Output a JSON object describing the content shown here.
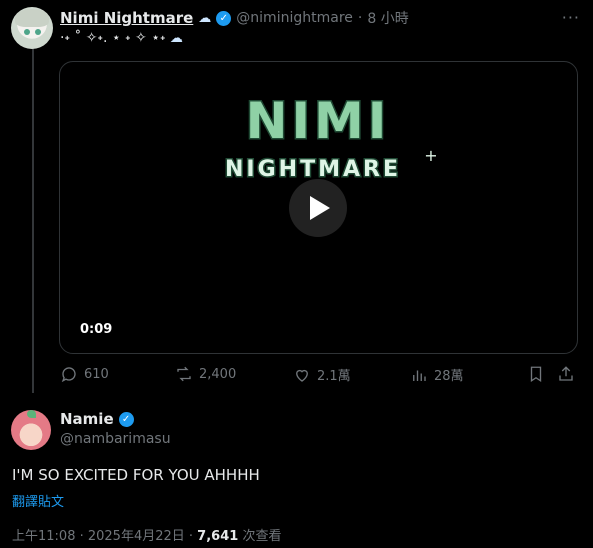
{
  "tweet": {
    "display_name": "Nimi Nightmare",
    "handle": "@niminightmare",
    "separator": "·",
    "time_ago": "8 小時",
    "text": "·˖ ˚ ✧˖. ⋆ ˖ ✧ ⋆˖",
    "video": {
      "logo_line1": "NIMI",
      "logo_line2": "NIGHTMARE",
      "duration": "0:09"
    },
    "actions": {
      "replies": "610",
      "reposts": "2,400",
      "likes": "2.1萬",
      "views": "28萬"
    }
  },
  "reply": {
    "display_name": "Namie",
    "handle": "@nambarimasu",
    "text": "I'M SO EXCITED FOR YOU AHHHH",
    "translate_label": "翻譯貼文",
    "timestamp": "上午11:08 · 2025年4月22日 ·",
    "views_count": "7,641",
    "views_label": "次查看"
  },
  "icons": {
    "more": "more-dots-icon",
    "play": "play-icon",
    "reply": "reply-icon",
    "repost": "repost-icon",
    "like": "heart-icon",
    "views": "analytics-icon",
    "bookmark": "bookmark-icon",
    "share": "share-icon"
  },
  "colors": {
    "accent": "#1d9bf0",
    "muted": "#71767b",
    "logo_green": "#8fd1a6"
  }
}
